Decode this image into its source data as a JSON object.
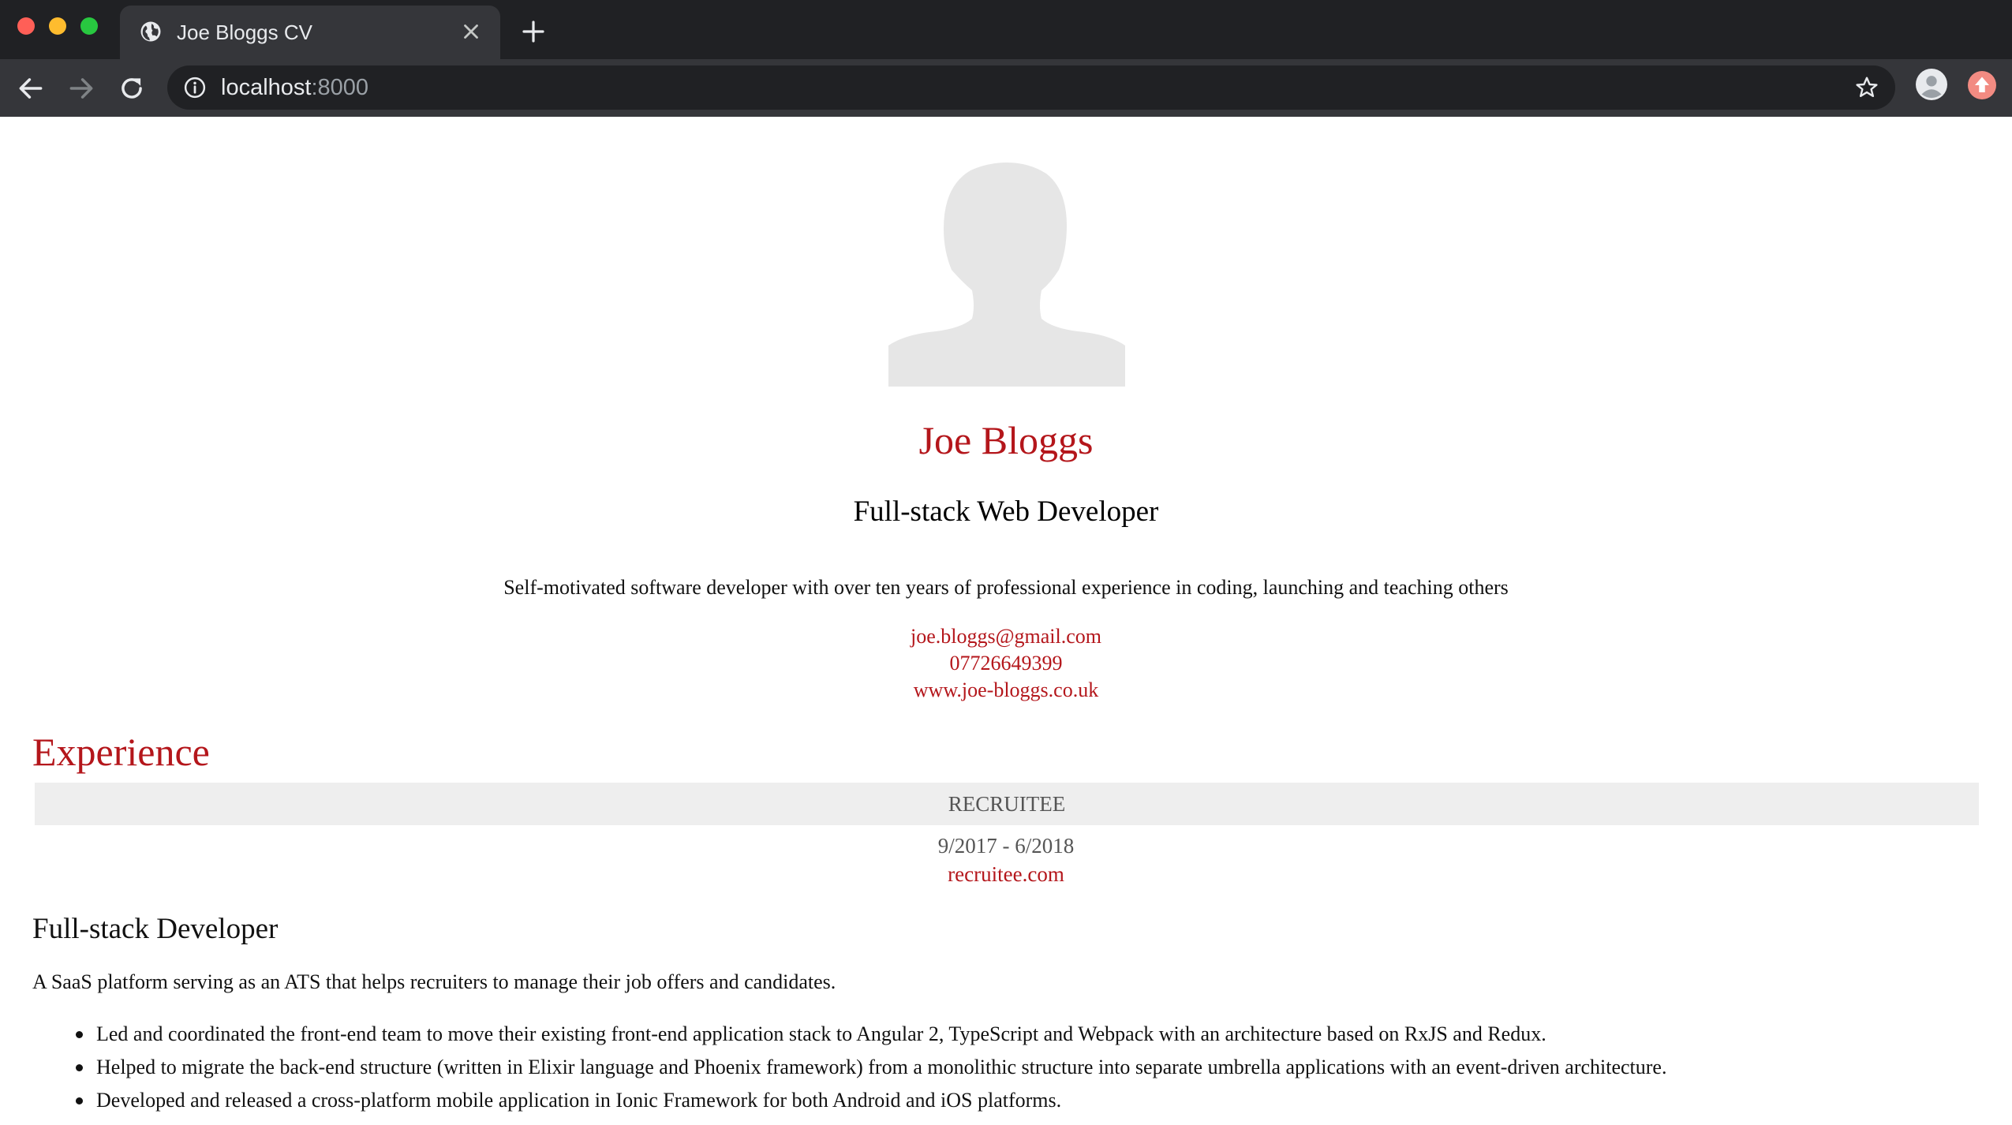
{
  "browser": {
    "tab_title": "Joe Bloggs CV",
    "url_host": "localhost",
    "url_port": ":8000"
  },
  "profile": {
    "name": "Joe Bloggs",
    "role": "Full-stack Web Developer",
    "summary": "Self-motivated software developer with over ten years of professional experience in coding, launching and teaching others",
    "email": "joe.bloggs@gmail.com",
    "phone": "07726649399",
    "website": "www.joe-bloggs.co.uk"
  },
  "experience": {
    "section_title": "Experience",
    "jobs": [
      {
        "company": "RECRUITEE",
        "dates": "9/2017 - 6/2018",
        "site": "recruitee.com",
        "title": "Full-stack Developer",
        "description": "A SaaS platform serving as an ATS that helps recruiters to manage their job offers and candidates.",
        "bullets": [
          "Led and coordinated the front-end team to move their existing front-end application stack to Angular 2, TypeScript and Webpack with an architecture based on RxJS and Redux.",
          "Helped to migrate the back-end structure (written in Elixir language and Phoenix framework) from a monolithic structure into separate umbrella applications with an event-driven architecture.",
          "Developed and released a cross-platform mobile application in Ionic Framework for both Android and iOS platforms."
        ]
      }
    ]
  },
  "colors": {
    "accent": "#b4161b",
    "chrome_dark": "#202124",
    "chrome_tab": "#35363a",
    "company_bar": "#eeeeee"
  },
  "icons": [
    "globe-icon",
    "close-icon",
    "plus-icon",
    "back-arrow-icon",
    "forward-arrow-icon",
    "reload-icon",
    "info-icon",
    "star-icon",
    "profile-icon",
    "extension-icon",
    "avatar-placeholder"
  ]
}
